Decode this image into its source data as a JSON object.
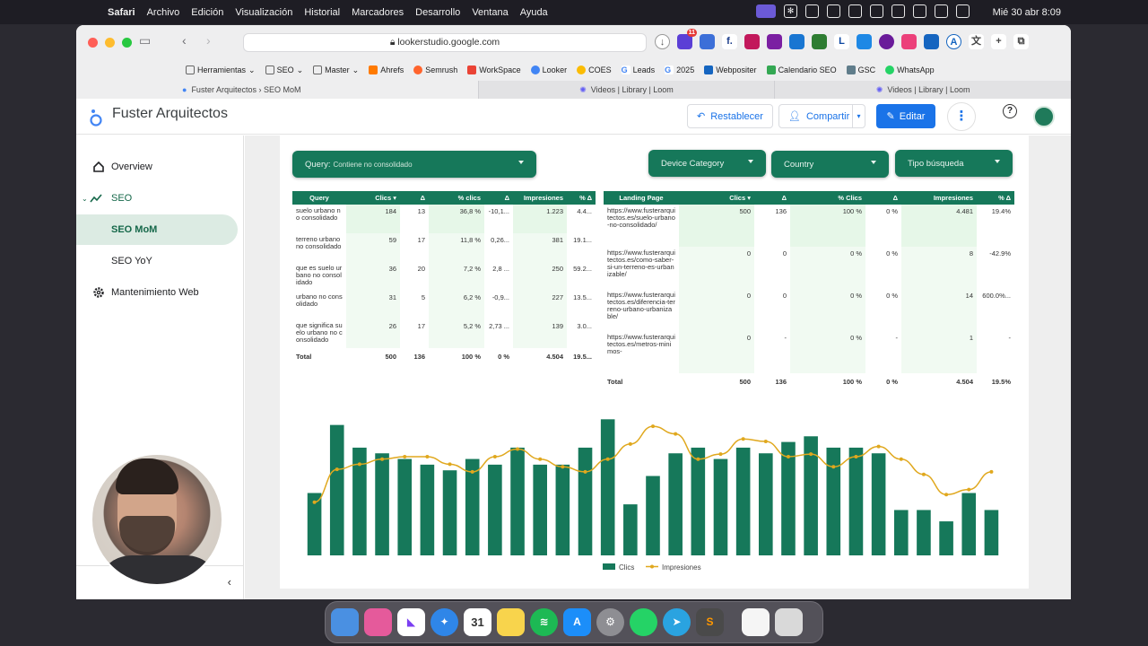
{
  "menubar": {
    "app": "Safari",
    "items": [
      "Archivo",
      "Edición",
      "Visualización",
      "Historial",
      "Marcadores",
      "Desarrollo",
      "Ventana",
      "Ayuda"
    ],
    "clock": "Mié 30 abr 8:09"
  },
  "browser": {
    "url": "lookerstudio.google.com",
    "bookmarks": [
      "Herramientas",
      "SEO",
      "Master",
      "Ahrefs",
      "Semrush",
      "WorkSpace",
      "Looker",
      "COES",
      "Leads",
      "2025",
      "Webpositer",
      "Calendario SEO",
      "GSC",
      "WhatsApp"
    ],
    "tabs": [
      "Fuster Arquitectos › SEO MoM",
      "Videos | Library | Loom",
      "Videos | Library | Loom"
    ],
    "badge_count": "11"
  },
  "report": {
    "title": "Fuster Arquitectos",
    "reset_label": "Restablecer",
    "share_label": "Compartir",
    "edit_label": "Editar"
  },
  "sidebar": {
    "overview": "Overview",
    "seo": "SEO",
    "seo_mom": "SEO MoM",
    "seo_yoy": "SEO YoY",
    "maintenance": "Mantenimiento Web"
  },
  "filters": {
    "query_label": "Query:",
    "query_value": "Contiene no consolidado",
    "device": "Device Category",
    "country": "Country",
    "search_type": "Tipo búsqueda"
  },
  "query_table": {
    "headers": [
      "Query",
      "Clics ▾",
      "Δ",
      "% clics",
      "Δ",
      "Impresiones",
      "% Δ"
    ],
    "rows": [
      [
        "suelo urbano no consolidado",
        "184",
        "13",
        "36,8 %",
        "-10,1...",
        "1.223",
        "4.4..."
      ],
      [
        "terreno urbano no consolidado",
        "59",
        "17",
        "11,8 %",
        "0,26...",
        "381",
        "19.1..."
      ],
      [
        "que es suelo urbano no consolidado",
        "36",
        "20",
        "7,2 %",
        "2,8 ...",
        "250",
        "59.2..."
      ],
      [
        "urbano no consolidado",
        "31",
        "5",
        "6,2 %",
        "-0,9...",
        "227",
        "13.5..."
      ],
      [
        "que significa suelo urbano no consolidado",
        "26",
        "17",
        "5,2 %",
        "2,73 ...",
        "139",
        "3.0..."
      ]
    ],
    "total": [
      "Total",
      "500",
      "136",
      "100 %",
      "0 %",
      "4.504",
      "19.5..."
    ]
  },
  "landing_table": {
    "headers": [
      "Landing Page",
      "Clics ▾",
      "Δ",
      "% Clics",
      "Δ",
      "Impresiones",
      "% Δ"
    ],
    "rows": [
      [
        "https://www.fusterarquitectos.es/suelo-urbano-no-consolidado/",
        "500",
        "136",
        "100 %",
        "0 %",
        "4.481",
        "19.4%"
      ],
      [
        "https://www.fusterarquitectos.es/como-saber-si-un-terreno-es-urbanizable/",
        "0",
        "0",
        "0 %",
        "0 %",
        "8",
        "-42.9%"
      ],
      [
        "https://www.fusterarquitectos.es/diferencia-terreno-urbano-urbanizable/",
        "0",
        "0",
        "0 %",
        "0 %",
        "14",
        "600.0%..."
      ],
      [
        "https://www.fusterarquitectos.es/metros-minimos-",
        "0",
        "-",
        "0 %",
        "-",
        "1",
        "-"
      ]
    ],
    "total": [
      "Total",
      "500",
      "136",
      "100 %",
      "0 %",
      "4.504",
      "19.5%"
    ]
  },
  "colors": {
    "brand": "#16785a",
    "line": "#e0a81e",
    "accent": "#1a73e8"
  },
  "chart_data": {
    "type": "bar",
    "series": [
      {
        "name": "Clics",
        "type": "bar",
        "values": [
          11,
          23,
          19,
          18,
          17,
          16,
          15,
          17,
          16,
          19,
          16,
          16,
          19,
          24,
          9,
          14,
          18,
          19,
          17,
          19,
          18,
          20,
          21,
          19,
          19,
          18,
          8,
          8,
          6,
          11,
          8
        ]
      },
      {
        "name": "Impresiones",
        "type": "line",
        "values": [
          105,
          170,
          180,
          190,
          195,
          195,
          180,
          165,
          195,
          210,
          190,
          175,
          165,
          190,
          220,
          255,
          240,
          190,
          200,
          230,
          225,
          195,
          200,
          175,
          195,
          215,
          190,
          160,
          120,
          130,
          165
        ]
      }
    ],
    "legend": [
      "Clics",
      "Impresiones"
    ],
    "legend_position": "bottom"
  }
}
